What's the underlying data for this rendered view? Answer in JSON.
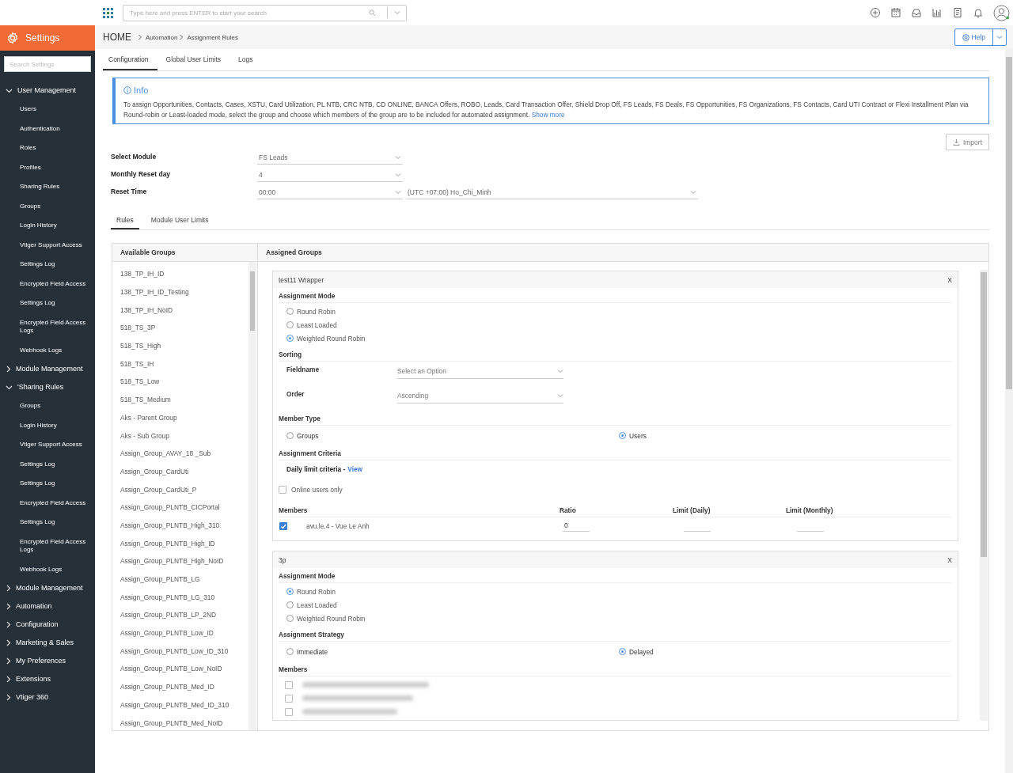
{
  "header": {
    "search": {
      "placeholder": "Type here and press ENTER to start your search"
    }
  },
  "sidebar": {
    "title": "Settings",
    "search": {
      "placeholder": "Search Settings"
    },
    "items": [
      {
        "label": "User Management",
        "expanded": true,
        "children": [
          {
            "label": "Users"
          },
          {
            "label": "Authentication"
          },
          {
            "label": "Roles"
          },
          {
            "label": "Profiles"
          },
          {
            "label": "Sharing Rules"
          },
          {
            "label": "Groups"
          },
          {
            "label": "Login History"
          },
          {
            "label": "Vtiger Support Access"
          },
          {
            "label": "Settings Log"
          },
          {
            "label": "Encrypted Field Access"
          },
          {
            "label": "Settings Log"
          },
          {
            "label": "Encrypted Field Access Logs"
          },
          {
            "label": "Webhook Logs"
          }
        ]
      },
      {
        "label": "Module Management",
        "expanded": false
      },
      {
        "label": "'Sharing Rules",
        "expanded": true,
        "children": [
          {
            "label": "Groups"
          },
          {
            "label": "Login History"
          },
          {
            "label": "Vtiger Support Access"
          },
          {
            "label": "Settings Log"
          },
          {
            "label": "Settings Log"
          },
          {
            "label": "Encrypted Field Access"
          },
          {
            "label": "Settings Log"
          },
          {
            "label": "Encrypted Field Access Logs"
          },
          {
            "label": "Webhook Logs"
          }
        ]
      },
      {
        "label": "Module Management",
        "expanded": false
      },
      {
        "label": "Automation",
        "expanded": false
      },
      {
        "label": "Configuration",
        "expanded": false
      },
      {
        "label": "Marketing & Sales",
        "expanded": false
      },
      {
        "label": "My Preferences",
        "expanded": false
      },
      {
        "label": "Extensions",
        "expanded": false
      },
      {
        "label": "Vtiger 360",
        "expanded": false
      }
    ]
  },
  "breadcrumb": [
    "HOME",
    "Automation",
    "Assignment Rules"
  ],
  "help_button": "Help",
  "tabs": [
    {
      "label": "Configuration",
      "selected": true
    },
    {
      "label": "Global User Limits",
      "selected": false
    },
    {
      "label": "Logs",
      "selected": false
    }
  ],
  "info": {
    "title": "Info",
    "text": "To assign Opportunities, Contacts, Cases, XSTU, Card Utilization, PL NTB, CRC NTB, CD ONLINE, BANCA Offers, ROBO, Leads, Card Transaction Offer, Shield Drop Off, FS Leads, FS Deals, FS Opportunities, FS Organizations, FS Contacts, Card UTI Contract or Flexi Installment Plan via Round-robin or Least-loaded mode, select the group and choose which members of the group are to be included for automated assignment.",
    "link": "Show more"
  },
  "import_button": "Import",
  "settings": [
    {
      "label": "Select Module",
      "values": [
        "FS Leads"
      ]
    },
    {
      "label": "Monthly Reset day",
      "values": [
        "4"
      ]
    },
    {
      "label": "Reset Time",
      "values": [
        "00:00",
        "(UTC +07:00) Ho_Chi_Minh"
      ]
    }
  ],
  "sub_tabs": [
    {
      "label": "Rules",
      "selected": true
    },
    {
      "label": "Module User Limits",
      "selected": false
    }
  ],
  "available_groups": {
    "title": "Available Groups",
    "items": [
      "138_TP_IH_ID",
      "138_TP_IH_ID_Testing",
      "138_TP_IH_NoID",
      "518_TS_3P",
      "518_TS_High",
      "518_TS_IH",
      "518_TS_Low",
      "518_TS_Medium",
      "Aks - Parent Group",
      "Aks - Sub Group",
      "Assign_Group_AVAY_18 _Sub",
      "Assign_Group_CardUti",
      "Assign_Group_CardUti_P",
      "Assign_Group_PLNTB_CICPortal",
      "Assign_Group_PLNTB_High_310",
      "Assign_Group_PLNTB_High_ID",
      "Assign_Group_PLNTB_High_NoID",
      "Assign_Group_PLNTB_LG",
      "Assign_Group_PLNTB_LG_310",
      "Assign_Group_PLNTB_LP_2ND",
      "Assign_Group_PLNTB_Low_ID",
      "Assign_Group_PLNTB_Low_ID_310",
      "Assign_Group_PLNTB_Low_NoID",
      "Assign_Group_PLNTB_Med_ID",
      "Assign_Group_PLNTB_Med_ID_310",
      "Assign_Group_PLNTB_Med_NoID"
    ]
  },
  "assigned_groups": {
    "title": "Assigned Groups",
    "cards": [
      {
        "title": "test11 Wrapper",
        "close": "X",
        "sections": [
          {
            "kind": "radio_column",
            "title": "Assignment Mode",
            "options": [
              {
                "label": "Round Robin",
                "selected": false
              },
              {
                "label": "Least Loaded",
                "selected": false
              },
              {
                "label": "Weighted Round Robin",
                "selected": true
              }
            ]
          },
          {
            "kind": "fields",
            "title": "Sorting",
            "fields": [
              {
                "label": "Fieldname",
                "value": "Select an Option"
              },
              {
                "label": "Order",
                "value": "Ascending"
              }
            ]
          },
          {
            "kind": "radio_row",
            "title": "Member Type",
            "options": [
              {
                "label": "Groups",
                "selected": false
              },
              {
                "label": "Users",
                "selected": true
              }
            ]
          },
          {
            "kind": "criteria",
            "title": "Assignment Criteria",
            "text": "Daily limit criteria -",
            "link": "View",
            "checkbox": {
              "label": "Online users only",
              "checked": false
            }
          },
          {
            "kind": "member_table",
            "columns": [
              "Members",
              "Ratio",
              "Limit (Daily)",
              "Limit (Monthly)"
            ],
            "rows": [
              {
                "checked": true,
                "name": "avu.le.4 - Vue Le Anh",
                "ratio": "0"
              }
            ]
          }
        ]
      },
      {
        "title": "3p",
        "close": "X",
        "sections": [
          {
            "kind": "radio_column",
            "title": "Assignment Mode",
            "options": [
              {
                "label": "Round Robin",
                "selected": true
              },
              {
                "label": "Least Loaded",
                "selected": false
              },
              {
                "label": "Weighted Round Robin",
                "selected": false
              }
            ]
          },
          {
            "kind": "radio_row",
            "title": "Assignment Strategy",
            "options": [
              {
                "label": "Immediate",
                "selected": false
              },
              {
                "label": "Delayed",
                "selected": true
              }
            ]
          },
          {
            "kind": "member_list",
            "title": "Members",
            "rows": [
              {
                "checked": false
              },
              {
                "checked": false
              },
              {
                "checked": false
              }
            ]
          }
        ]
      }
    ]
  }
}
